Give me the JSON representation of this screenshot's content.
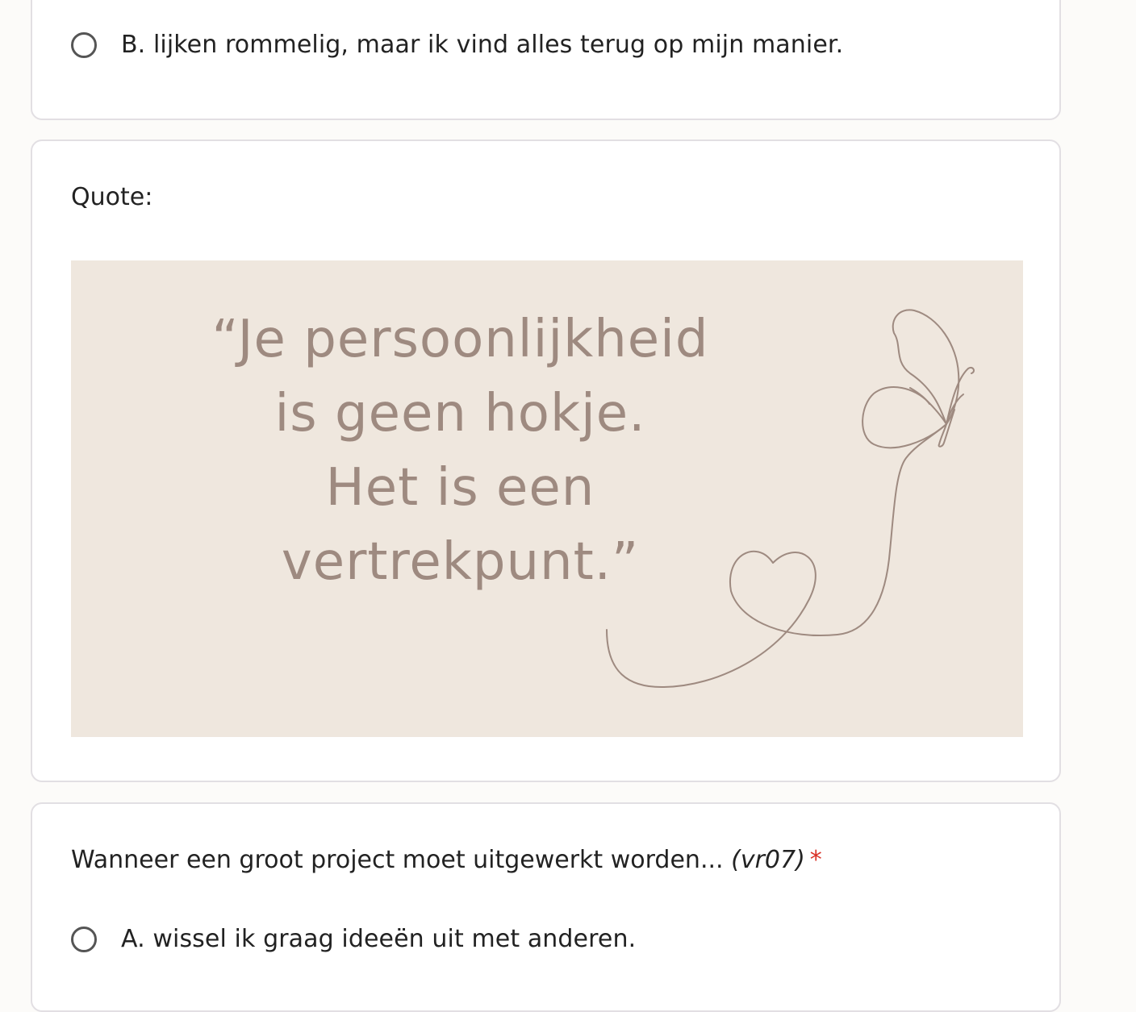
{
  "colors": {
    "page_background": "#fcfbf9",
    "card_background": "#ffffff",
    "card_border": "#e2dfe3",
    "quote_background": "#efe7de",
    "quote_text": "#9e8a80",
    "required_star": "#d93025"
  },
  "previous_question": {
    "options": [
      {
        "label": "B. lijken rommelig, maar ik vind alles terug op mijn manier.",
        "selected": false
      }
    ]
  },
  "quote_section": {
    "label": "Quote:",
    "image": {
      "lines": [
        "“Je persoonlijkheid",
        "is geen hokje.",
        "Het is een",
        "vertrekpunt.”"
      ],
      "decoration": "butterfly-and-heart-line-drawing"
    }
  },
  "question_07": {
    "text": "Wanneer een groot project moet uitgewerkt worden...",
    "code": "(vr07)",
    "required_marker": "*",
    "options": [
      {
        "label": "A. wissel ik graag ideeën uit met anderen.",
        "selected": false
      }
    ]
  }
}
